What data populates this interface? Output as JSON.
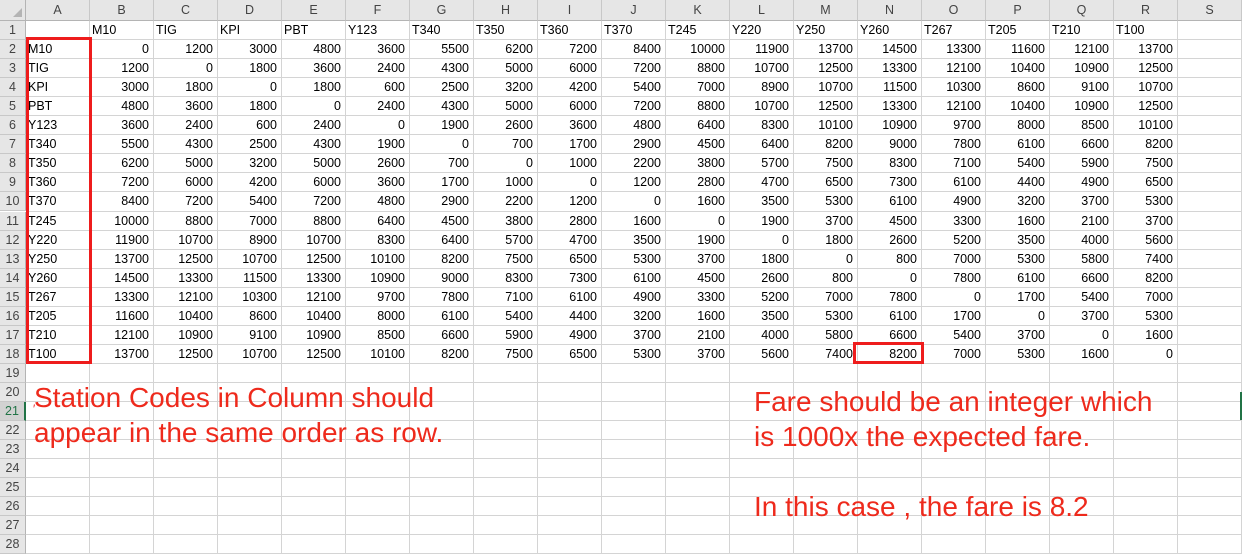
{
  "columns": [
    "A",
    "B",
    "C",
    "D",
    "E",
    "F",
    "G",
    "H",
    "I",
    "J",
    "K",
    "L",
    "M",
    "N",
    "O",
    "P",
    "Q",
    "R",
    "S"
  ],
  "rows": [
    "1",
    "2",
    "3",
    "4",
    "5",
    "6",
    "7",
    "8",
    "9",
    "10",
    "11",
    "12",
    "13",
    "14",
    "15",
    "16",
    "17",
    "18",
    "19",
    "20",
    "21",
    "22",
    "23",
    "24",
    "25",
    "26",
    "27",
    "28"
  ],
  "selected_row": "21",
  "header_row": [
    "",
    "M10",
    "TIG",
    "KPI",
    "PBT",
    "Y123",
    "T340",
    "T350",
    "T360",
    "T370",
    "T245",
    "Y220",
    "Y250",
    "Y260",
    "T267",
    "T205",
    "T210",
    "T100"
  ],
  "data_rows": [
    {
      "station": "M10",
      "values": [
        "0",
        "1200",
        "3000",
        "4800",
        "3600",
        "5500",
        "6200",
        "7200",
        "8400",
        "10000",
        "11900",
        "13700",
        "14500",
        "13300",
        "11600",
        "12100",
        "13700"
      ]
    },
    {
      "station": "TIG",
      "values": [
        "1200",
        "0",
        "1800",
        "3600",
        "2400",
        "4300",
        "5000",
        "6000",
        "7200",
        "8800",
        "10700",
        "12500",
        "13300",
        "12100",
        "10400",
        "10900",
        "12500"
      ]
    },
    {
      "station": "KPI",
      "values": [
        "3000",
        "1800",
        "0",
        "1800",
        "600",
        "2500",
        "3200",
        "4200",
        "5400",
        "7000",
        "8900",
        "10700",
        "11500",
        "10300",
        "8600",
        "9100",
        "10700"
      ]
    },
    {
      "station": "PBT",
      "values": [
        "4800",
        "3600",
        "1800",
        "0",
        "2400",
        "4300",
        "5000",
        "6000",
        "7200",
        "8800",
        "10700",
        "12500",
        "13300",
        "12100",
        "10400",
        "10900",
        "12500"
      ]
    },
    {
      "station": "Y123",
      "values": [
        "3600",
        "2400",
        "600",
        "2400",
        "0",
        "1900",
        "2600",
        "3600",
        "4800",
        "6400",
        "8300",
        "10100",
        "10900",
        "9700",
        "8000",
        "8500",
        "10100"
      ]
    },
    {
      "station": "T340",
      "values": [
        "5500",
        "4300",
        "2500",
        "4300",
        "1900",
        "0",
        "700",
        "1700",
        "2900",
        "4500",
        "6400",
        "8200",
        "9000",
        "7800",
        "6100",
        "6600",
        "8200"
      ]
    },
    {
      "station": "T350",
      "values": [
        "6200",
        "5000",
        "3200",
        "5000",
        "2600",
        "700",
        "0",
        "1000",
        "2200",
        "3800",
        "5700",
        "7500",
        "8300",
        "7100",
        "5400",
        "5900",
        "7500"
      ]
    },
    {
      "station": "T360",
      "values": [
        "7200",
        "6000",
        "4200",
        "6000",
        "3600",
        "1700",
        "1000",
        "0",
        "1200",
        "2800",
        "4700",
        "6500",
        "7300",
        "6100",
        "4400",
        "4900",
        "6500"
      ]
    },
    {
      "station": "T370",
      "values": [
        "8400",
        "7200",
        "5400",
        "7200",
        "4800",
        "2900",
        "2200",
        "1200",
        "0",
        "1600",
        "3500",
        "5300",
        "6100",
        "4900",
        "3200",
        "3700",
        "5300"
      ]
    },
    {
      "station": "T245",
      "values": [
        "10000",
        "8800",
        "7000",
        "8800",
        "6400",
        "4500",
        "3800",
        "2800",
        "1600",
        "0",
        "1900",
        "3700",
        "4500",
        "3300",
        "1600",
        "2100",
        "3700"
      ]
    },
    {
      "station": "Y220",
      "values": [
        "11900",
        "10700",
        "8900",
        "10700",
        "8300",
        "6400",
        "5700",
        "4700",
        "3500",
        "1900",
        "0",
        "1800",
        "2600",
        "5200",
        "3500",
        "4000",
        "5600"
      ]
    },
    {
      "station": "Y250",
      "values": [
        "13700",
        "12500",
        "10700",
        "12500",
        "10100",
        "8200",
        "7500",
        "6500",
        "5300",
        "3700",
        "1800",
        "0",
        "800",
        "7000",
        "5300",
        "5800",
        "7400"
      ]
    },
    {
      "station": "Y260",
      "values": [
        "14500",
        "13300",
        "11500",
        "13300",
        "10900",
        "9000",
        "8300",
        "7300",
        "6100",
        "4500",
        "2600",
        "800",
        "0",
        "7800",
        "6100",
        "6600",
        "8200"
      ]
    },
    {
      "station": "T267",
      "values": [
        "13300",
        "12100",
        "10300",
        "12100",
        "9700",
        "7800",
        "7100",
        "6100",
        "4900",
        "3300",
        "5200",
        "7000",
        "7800",
        "0",
        "1700",
        "5400",
        "7000"
      ]
    },
    {
      "station": "T205",
      "values": [
        "11600",
        "10400",
        "8600",
        "10400",
        "8000",
        "6100",
        "5400",
        "4400",
        "3200",
        "1600",
        "3500",
        "5300",
        "6100",
        "1700",
        "0",
        "3700",
        "5300"
      ]
    },
    {
      "station": "T210",
      "values": [
        "12100",
        "10900",
        "9100",
        "10900",
        "8500",
        "6600",
        "5900",
        "4900",
        "3700",
        "2100",
        "4000",
        "5800",
        "6600",
        "5400",
        "3700",
        "0",
        "1600"
      ]
    },
    {
      "station": "T100",
      "values": [
        "13700",
        "12500",
        "10700",
        "12500",
        "10100",
        "8200",
        "7500",
        "6500",
        "5300",
        "3700",
        "5600",
        "7400",
        "8200",
        "7000",
        "5300",
        "1600",
        "0"
      ]
    }
  ],
  "annotations": {
    "left_note": "Station Codes in Column should\nappear in the same order as row.",
    "right_note": "Fare should be an integer which\nis 1000x the expected fare.\n\nIn this case , the fare is 8.2",
    "stray_mark": "′",
    "color": "#ee1c1c"
  }
}
